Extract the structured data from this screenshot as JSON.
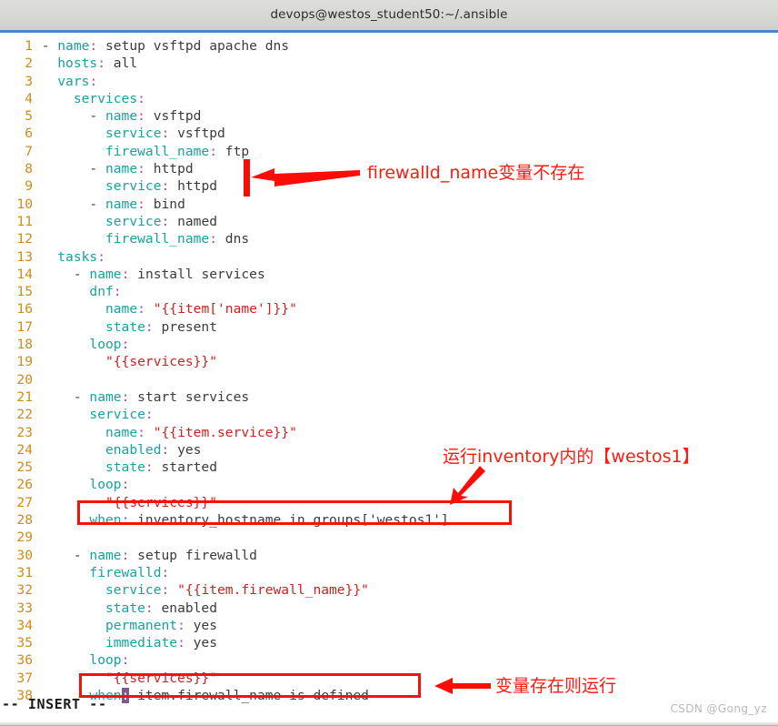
{
  "window": {
    "title": "devops@westos_student50:~/.ansible"
  },
  "editor": {
    "mode_status": "-- INSERT --",
    "lines": [
      {
        "n": "1",
        "text": "- name: setup vsftpd apache dns"
      },
      {
        "n": "2",
        "text": "  hosts: all"
      },
      {
        "n": "3",
        "text": "  vars:"
      },
      {
        "n": "4",
        "text": "    services:"
      },
      {
        "n": "5",
        "text": "      - name: vsftpd"
      },
      {
        "n": "6",
        "text": "        service: vsftpd"
      },
      {
        "n": "7",
        "text": "        firewall_name: ftp"
      },
      {
        "n": "8",
        "text": "      - name: httpd"
      },
      {
        "n": "9",
        "text": "        service: httpd"
      },
      {
        "n": "10",
        "text": "      - name: bind"
      },
      {
        "n": "11",
        "text": "        service: named"
      },
      {
        "n": "12",
        "text": "        firewall_name: dns"
      },
      {
        "n": "13",
        "text": "  tasks:"
      },
      {
        "n": "14",
        "text": "    - name: install services"
      },
      {
        "n": "15",
        "text": "      dnf:"
      },
      {
        "n": "16",
        "text": "        name: \"{{item['name']}}\""
      },
      {
        "n": "17",
        "text": "        state: present"
      },
      {
        "n": "18",
        "text": "      loop:"
      },
      {
        "n": "19",
        "text": "        \"{{services}}\""
      },
      {
        "n": "20",
        "text": ""
      },
      {
        "n": "21",
        "text": "    - name: start services"
      },
      {
        "n": "22",
        "text": "      service:"
      },
      {
        "n": "23",
        "text": "        name: \"{{item.service}}\""
      },
      {
        "n": "24",
        "text": "        enabled: yes"
      },
      {
        "n": "25",
        "text": "        state: started"
      },
      {
        "n": "26",
        "text": "      loop:"
      },
      {
        "n": "27",
        "text": "        \"{{services}}\""
      },
      {
        "n": "28",
        "text": "      when: inventory_hostname in groups['westos1']"
      },
      {
        "n": "29",
        "text": ""
      },
      {
        "n": "30",
        "text": "    - name: setup firewalld"
      },
      {
        "n": "31",
        "text": "      firewalld:"
      },
      {
        "n": "32",
        "text": "        service: \"{{item.firewall_name}}\""
      },
      {
        "n": "33",
        "text": "        state: enabled"
      },
      {
        "n": "34",
        "text": "        permanent: yes"
      },
      {
        "n": "35",
        "text": "        immediate: yes"
      },
      {
        "n": "36",
        "text": "      loop:"
      },
      {
        "n": "37",
        "text": "        \"{{services}}\""
      },
      {
        "n": "38",
        "text": "      when: item.firewall_name is defined"
      }
    ]
  },
  "annotations": [
    {
      "id": "missing-var",
      "text": "firewalld_name变量不存在"
    },
    {
      "id": "inventory-group",
      "text": "运行inventory内的【westos1】"
    },
    {
      "id": "var-defined",
      "text": "变量存在则运行"
    }
  ],
  "watermark": {
    "text": "CSDN @Gong_yz"
  },
  "colors": {
    "annotation_red": "#ff1a11",
    "box_red": "#f41309",
    "line_number": "#d08b16",
    "yaml_key": "#19a0a0",
    "yaml_colon": "#9a4fc0",
    "yaml_string": "#d02020",
    "yaml_value": "#3b3b3b",
    "cursor": "#7d5a8c",
    "titlebar_accent": "#4a86c8"
  }
}
